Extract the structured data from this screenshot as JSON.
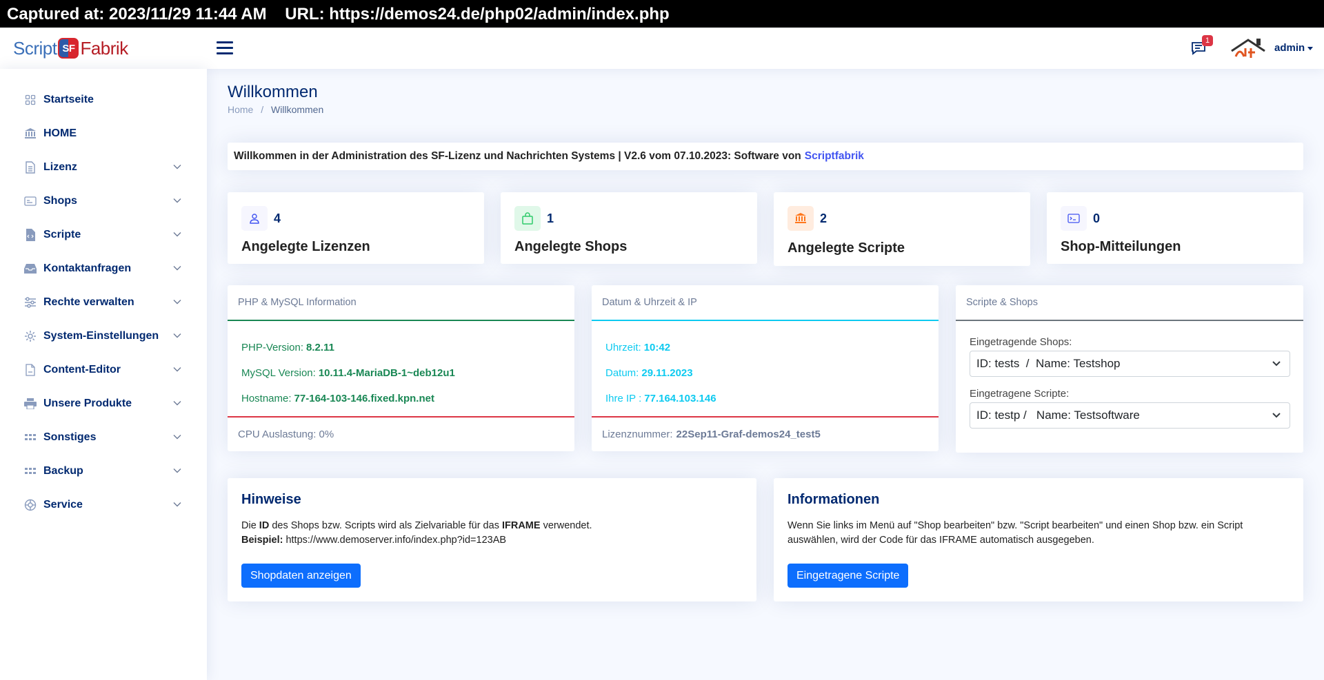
{
  "capture": {
    "text": "Captured at: 2023/11/29 11:44 AM    URL: https://demos24.de/php02/admin/index.php"
  },
  "header": {
    "logo": {
      "part1": "Script",
      "mark": "SF",
      "part2": "Fabrik"
    },
    "notification_count": "1",
    "user": "admin"
  },
  "sidebar": {
    "items": [
      {
        "label": "Startseite",
        "icon": "grid-icon",
        "expandable": false
      },
      {
        "label": "HOME",
        "icon": "bank-icon",
        "expandable": false
      },
      {
        "label": "Lizenz",
        "icon": "file-text-icon",
        "expandable": true
      },
      {
        "label": "Shops",
        "icon": "card-icon",
        "expandable": true
      },
      {
        "label": "Scripte",
        "icon": "file-code-icon",
        "expandable": true
      },
      {
        "label": "Kontaktanfragen",
        "icon": "inbox-icon",
        "expandable": true
      },
      {
        "label": "Rechte verwalten",
        "icon": "sliders-icon",
        "expandable": true
      },
      {
        "label": "System-Einstellungen",
        "icon": "gear-icon",
        "expandable": true
      },
      {
        "label": "Content-Editor",
        "icon": "document-icon",
        "expandable": true
      },
      {
        "label": "Unsere Produkte",
        "icon": "printer-icon",
        "expandable": true
      },
      {
        "label": "Sonstiges",
        "icon": "dots-grid-icon",
        "expandable": true
      },
      {
        "label": "Backup",
        "icon": "dots-grid-icon",
        "expandable": true
      },
      {
        "label": "Service",
        "icon": "service-icon",
        "expandable": true
      }
    ]
  },
  "page": {
    "title": "Willkommen",
    "breadcrumb": {
      "home": "Home",
      "sep": "/",
      "current": "Willkommen"
    }
  },
  "welcome": {
    "text": "Willkommen in der Administration des SF-Lizenz und Nachrichten Systems | V2.6 vom 07.10.2023: Software von",
    "link": "Scriptfabrik"
  },
  "stats": [
    {
      "value": "4",
      "label": "Angelegte Lizenzen",
      "color": "#4154f1",
      "bg": "#f6f6fe"
    },
    {
      "value": "1",
      "label": "Angelegte Shops",
      "color": "#2eca6a",
      "bg": "#e0f8e9"
    },
    {
      "value": "2",
      "label": "Angelegte Scripte",
      "color": "#ff771d",
      "bg": "#ffecdf"
    },
    {
      "value": "0",
      "label": "Shop-Mitteilungen",
      "color": "#4154f1",
      "bg": "#f6f6fe"
    }
  ],
  "php": {
    "title": "PHP & MySQL Information",
    "rows": [
      {
        "label": "PHP-Version:",
        "value": "8.2.11"
      },
      {
        "label": "MySQL Version:",
        "value": "10.11.4-MariaDB-1~deb12u1"
      },
      {
        "label": "Hostname:",
        "value": "77-164-103-146.fixed.kpn.net"
      }
    ],
    "footer": "CPU Auslastung: 0%",
    "color": "#198754"
  },
  "datetime": {
    "title": "Datum & Uhrzeit & IP",
    "rows": [
      {
        "label": "Uhrzeit:",
        "value": "10:42"
      },
      {
        "label": "Datum:",
        "value": "29.11.2023"
      },
      {
        "label": "Ihre IP :",
        "value": "77.164.103.146"
      }
    ],
    "footer_label": "Lizenznummer:",
    "footer_value": "22Sep11-Graf-demos24_test5",
    "color": "#0dcaf0"
  },
  "scripts_shops": {
    "title": "Scripte & Shops",
    "shops_label": "Eingetragende Shops:",
    "shops_selected": "ID: tests  /  Name: Testshop",
    "scripts_label": "Eingetragene Scripte:",
    "scripts_selected": "ID: testp /   Name: Testsoftware"
  },
  "hinweise": {
    "title": "Hinweise",
    "line1_a": "Die ",
    "line1_b": "ID",
    "line1_c": " des Shops bzw. Scripts wird als Zielvariable für das ",
    "line1_d": "IFRAME",
    "line1_e": " verwendet.",
    "line2_label": "Beispiel:",
    "line2_value": " https://www.demoserver.info/index.php?id=123AB",
    "button": "Shopdaten anzeigen"
  },
  "informationen": {
    "title": "Informationen",
    "text": "Wenn Sie links im Menü auf \"Shop bearbeiten\" bzw. \"Script bearbeiten\" und einen Shop bzw. ein Script auswählen, wird der Code für das IFRAME automatisch ausgegeben.",
    "button": "Eingetragene Scripte"
  }
}
